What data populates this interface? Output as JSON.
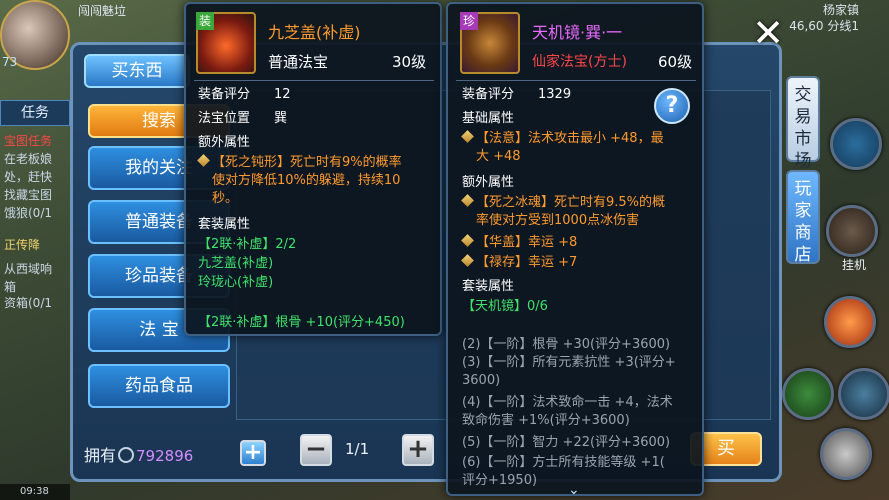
{
  "hud": {
    "top_name": "闯闯魅垃",
    "level": "73",
    "task_tab": "任务",
    "quests": [
      {
        "text": "宝图任务",
        "color": "red"
      },
      {
        "text": "在老板娘",
        "color": "normal"
      },
      {
        "text": "处，赶快",
        "color": "normal"
      },
      {
        "text": "找藏宝图",
        "color": "normal"
      },
      {
        "text": "饿狼(0/1",
        "color": "normal"
      },
      {
        "text": "正传降",
        "color": "yellow"
      },
      {
        "text": "从西域响",
        "color": "normal"
      },
      {
        "text": "箱",
        "color": "normal"
      },
      {
        "text": "资箱(0/1",
        "color": "normal"
      }
    ],
    "time": "09:38",
    "map_name": "杨家镇",
    "map_coords": "46,60 分线1",
    "hang_label": "挂机",
    "side_tab_trade": "交易市场",
    "side_tab_player_shop": "玩家商店"
  },
  "shop": {
    "title": "买东西",
    "categories": [
      {
        "label": "搜索",
        "active": true
      },
      {
        "label": "我的关注",
        "active": false
      },
      {
        "label": "普通装备",
        "active": false
      },
      {
        "label": "珍品装备",
        "active": false
      },
      {
        "label": "法 宝",
        "active": false
      },
      {
        "label": "药品食品",
        "active": false
      }
    ],
    "own_label": "拥有",
    "own_value": "792896",
    "page": "1/1",
    "buy_label": "买",
    "minus": "−",
    "plus": "+"
  },
  "card_left": {
    "tag": "装",
    "name": "九芝盖(补虚)",
    "type": "普通法宝",
    "level": "30级",
    "rating_label": "装备评分",
    "rating": "12",
    "slot_label": "法宝位置",
    "slot": "巽",
    "extra_label": "额外属性",
    "extra_lines": [
      "【死之钝形】死亡时有9%的概率",
      "使对方降低10%的躲避，持续10",
      "秒。"
    ],
    "set_label": "套装属性",
    "set_lines": [
      "【2联·补虚】2/2",
      "九芝盖(补虚)",
      "玲珑心(补虚)"
    ],
    "set_bonus": "【2联·补虚】根骨 +10(评分+450)"
  },
  "card_right": {
    "tag": "珍",
    "name": "天机镜·巽·一",
    "type": "仙家法宝(方士)",
    "level": "60级",
    "rating_label": "装备评分",
    "rating": "1329",
    "base_label": "基础属性",
    "base_lines": [
      "【法意】法术攻击最小 +48，最",
      "大 +48"
    ],
    "extra_label": "额外属性",
    "extra_lines": [
      "【死之冰魂】死亡时有9.5%的概",
      "率使对方受到1000点冰伤害"
    ],
    "extra2": [
      "【华盖】幸运 +8",
      "【禄存】幸运 +7"
    ],
    "set_label": "套装属性",
    "set_name": "【天机镜】0/6",
    "tiers": [
      "(2)【一阶】根骨 +30(评分+3600)",
      "(3)【一阶】所有元素抗性 +3(评分+",
      "3600)",
      "(4)【一阶】法术致命一击 +4，法术",
      "致命伤害 +1%(评分+3600)",
      "(5)【一阶】智力 +22(评分+3600)",
      "(6)【一阶】方士所有技能等级 +1(",
      "评分+1950)"
    ],
    "help": "?"
  },
  "colors": {
    "orange": "#ff9a2e",
    "green": "#3fe26a",
    "red": "#ff4646",
    "purple": "#e86bff",
    "panel_blue": "#24476a"
  }
}
